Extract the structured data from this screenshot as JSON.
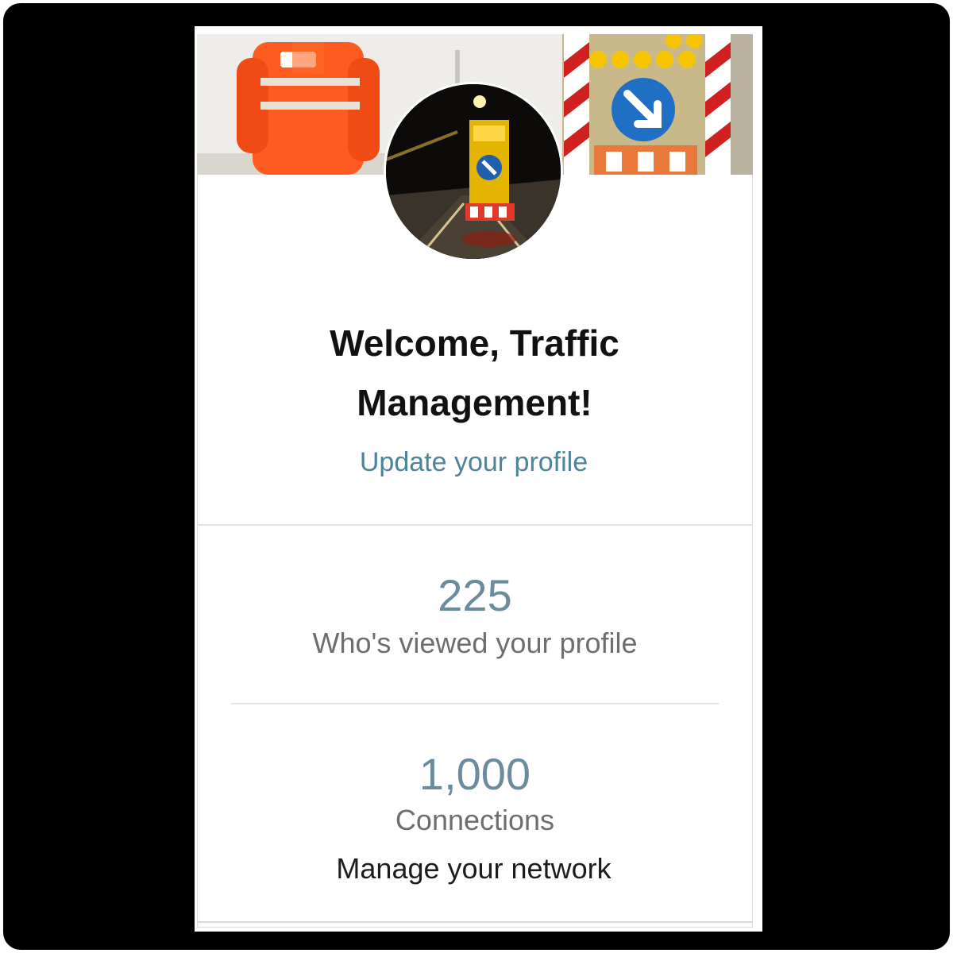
{
  "profile_card": {
    "welcome_text": "Welcome, Traffic Management!",
    "update_profile_link": "Update your profile",
    "stats": {
      "profile_views": {
        "value": "225",
        "label": "Who's viewed your profile"
      },
      "connections": {
        "value": "1,000",
        "label": "Connections"
      }
    },
    "manage_network_link": "Manage your network"
  },
  "colors": {
    "link": "#4c8498",
    "stat_number": "#6b8c9c",
    "hi_vis_orange": "#ff5a1f",
    "frame": "#000000"
  }
}
